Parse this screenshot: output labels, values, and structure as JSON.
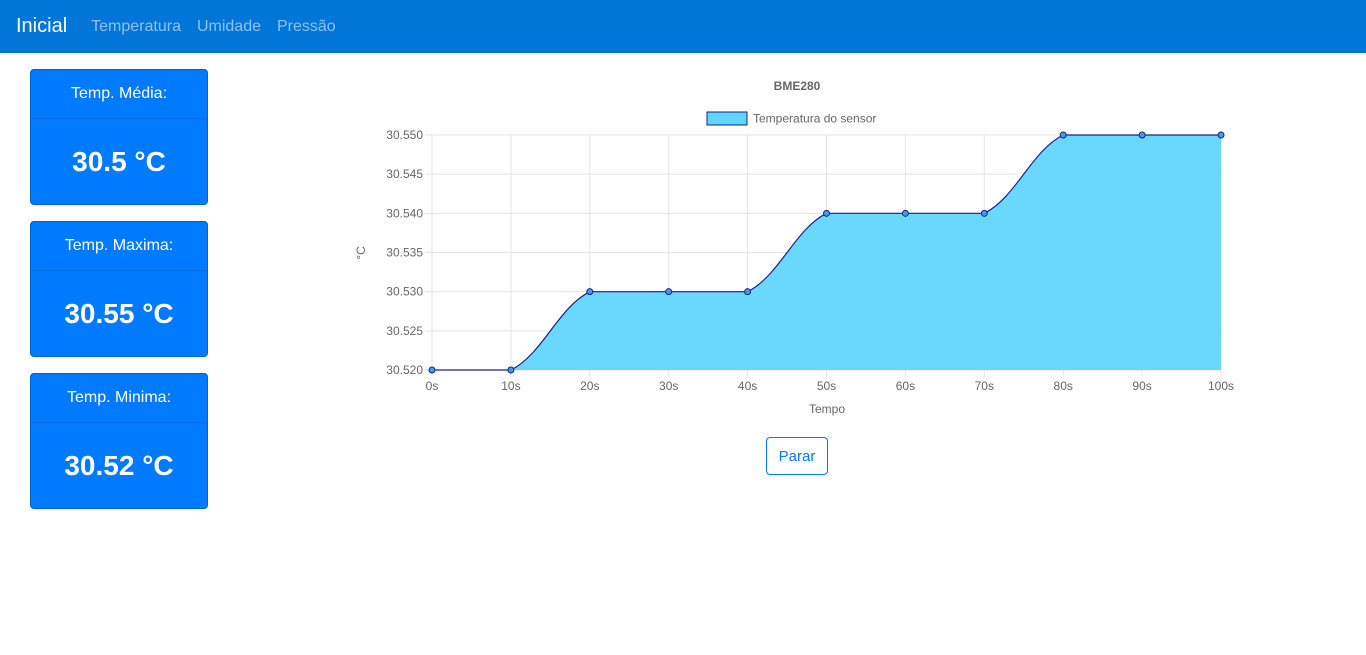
{
  "navbar": {
    "brand": "Inicial",
    "links": [
      "Temperatura",
      "Umidade",
      "Pressão"
    ]
  },
  "cards": [
    {
      "title": "Temp. Média:",
      "value": "30.5 °C"
    },
    {
      "title": "Temp. Maxima:",
      "value": "30.55 °C"
    },
    {
      "title": "Temp. Minima:",
      "value": "30.52 °C"
    }
  ],
  "stop_button": {
    "label": "Parar"
  },
  "colors": {
    "navbar": "#0275d8",
    "card": "#007bff",
    "series_fill": "#61d6fc",
    "series_line": "#1c1f8c"
  },
  "chart_data": {
    "type": "area",
    "title": "BME280",
    "xlabel": "Tempo",
    "ylabel": "°C",
    "x": [
      "0s",
      "10s",
      "20s",
      "30s",
      "40s",
      "50s",
      "60s",
      "70s",
      "80s",
      "90s",
      "100s"
    ],
    "series": [
      {
        "name": "Temperatura do sensor",
        "values": [
          30.52,
          30.52,
          30.53,
          30.53,
          30.53,
          30.54,
          30.54,
          30.54,
          30.55,
          30.55,
          30.55
        ]
      }
    ],
    "ylim": [
      30.52,
      30.55
    ],
    "yticks": [
      "30.550",
      "30.545",
      "30.540",
      "30.535",
      "30.530",
      "30.525",
      "30.520"
    ],
    "grid": true,
    "legend": "top-center"
  }
}
